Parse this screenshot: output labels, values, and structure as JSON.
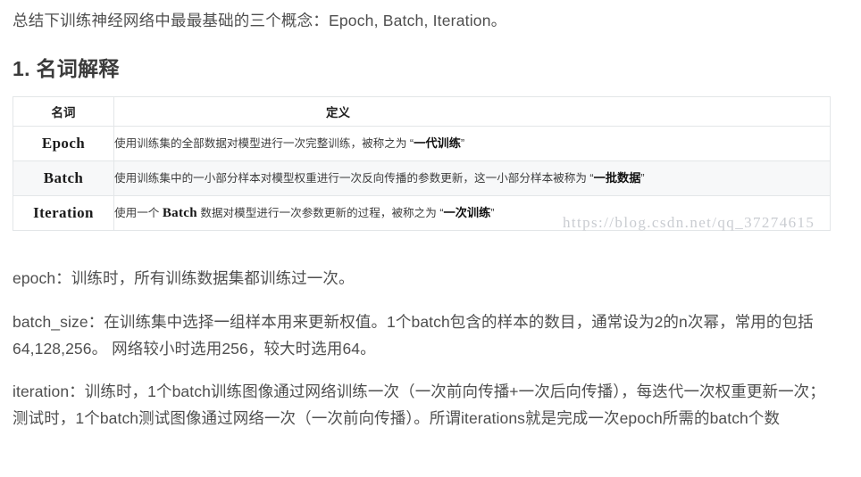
{
  "intro": "总结下训练神经网络中最最基础的三个概念：Epoch, Batch, Iteration。",
  "heading": "1. 名词解释",
  "table": {
    "headers": {
      "term": "名词",
      "definition": "定义"
    },
    "rows": [
      {
        "term": "Epoch",
        "definition_pre": "使用训练集的全部数据对模型进行一次完整训练，被称之为 “",
        "definition_strong": "一代训练",
        "definition_post": "”"
      },
      {
        "term": "Batch",
        "definition_pre": "使用训练集中的一小部分样本对模型权重进行一次反向传播的参数更新，这一小部分样本被称为 “",
        "definition_strong": "一批数据",
        "definition_post": "”"
      },
      {
        "term": "Iteration",
        "definition_pre_a": "使用一个 ",
        "definition_serif": "Batch",
        "definition_pre_b": " 数据对模型进行一次参数更新的过程，被称之为 “",
        "definition_strong": "一次训练",
        "definition_post": "”"
      }
    ]
  },
  "watermark": "https://blog.csdn.net/qq_37274615",
  "paragraphs": {
    "epoch": "epoch：训练时，所有训练数据集都训练过一次。",
    "batch_size": "batch_size：在训练集中选择一组样本用来更新权值。1个batch包含的样本的数目，通常设为2的n次幂，常用的包括64,128,256。 网络较小时选用256，较大时选用64。",
    "iteration": "iteration：训练时，1个batch训练图像通过网络训练一次（一次前向传播+一次后向传播），每迭代一次权重更新一次；测试时，1个batch测试图像通过网络一次（一次前向传播）。所谓iterations就是完成一次epoch所需的batch个数"
  },
  "colors": {
    "text": "#4f4f4f",
    "heading": "#3b3b3b",
    "table_border": "#e3e6e8",
    "alt_row": "#f7f8f9",
    "watermark": "#c9ccd1"
  }
}
